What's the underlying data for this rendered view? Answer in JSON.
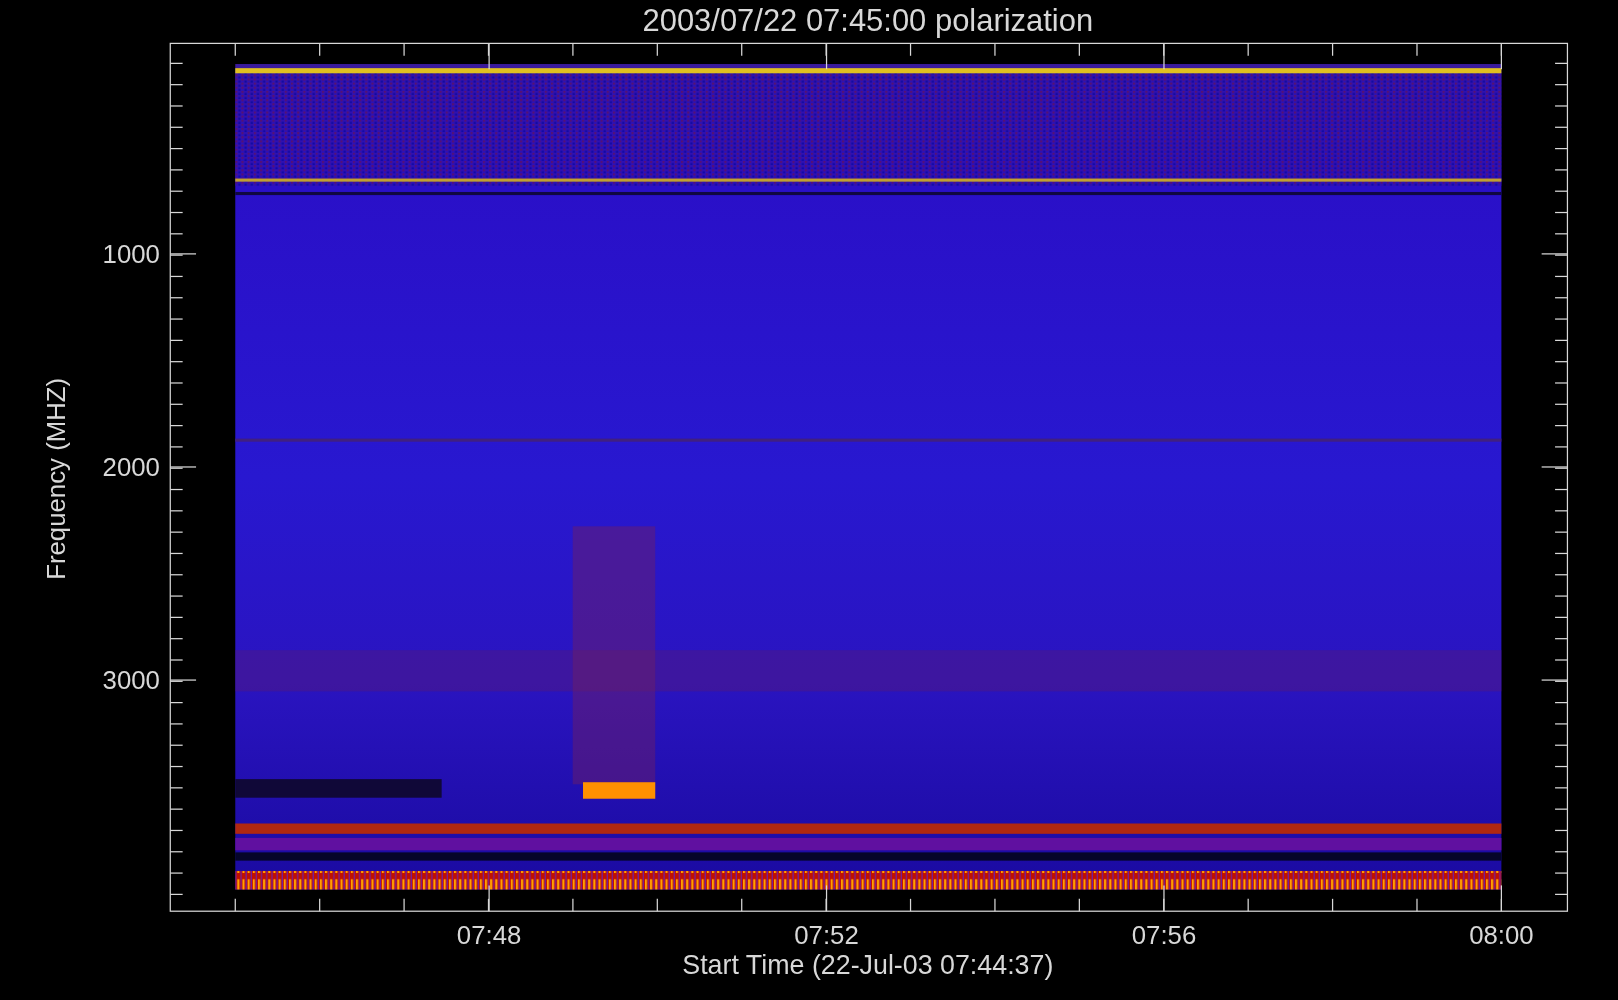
{
  "chart": {
    "title": "2003/07/22 07:45:00 polarization",
    "ylabel": "Frequency (MHZ)",
    "xlabel": "Start Time (22-Jul-03 07:44:37)",
    "yticks": [
      "1000",
      "2000",
      "3000"
    ],
    "xticks": [
      "07:48",
      "07:52",
      "07:56",
      "08:00"
    ]
  }
}
